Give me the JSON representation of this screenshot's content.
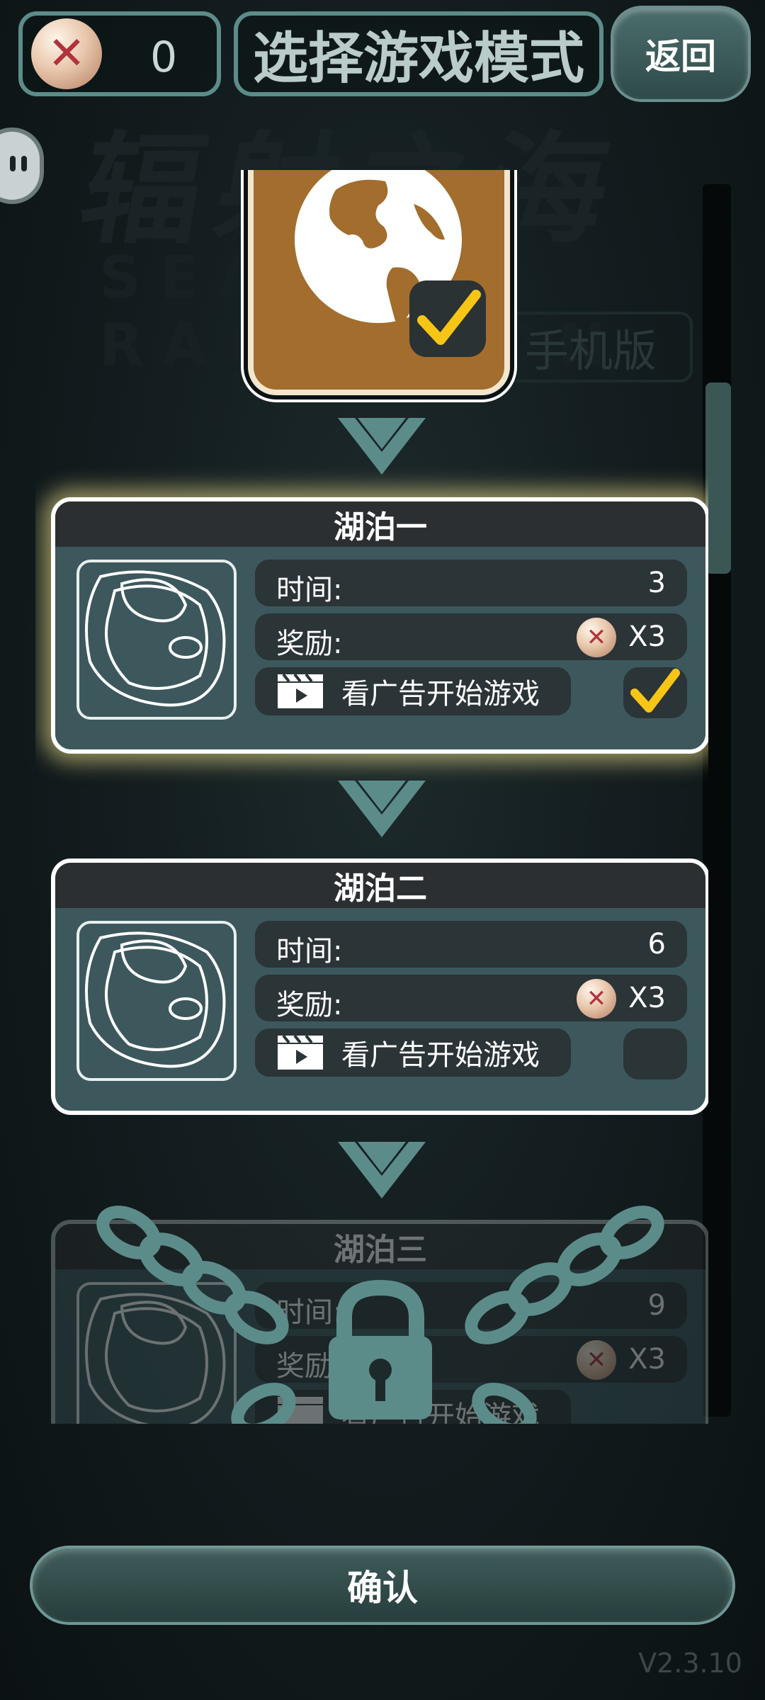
{
  "header": {
    "coin_count": "0",
    "title": "选择游戏模式",
    "back_label": "返回"
  },
  "background": {
    "title": "辐射之海",
    "subtitle": "SEA OF RADIATION",
    "edition": "手机版"
  },
  "levels": [
    {
      "name": "湖泊一",
      "time_label": "时间:",
      "time_value": "3",
      "reward_label": "奖励:",
      "reward_value": "X3",
      "ad_label": "看广告开始游戏",
      "checked": true,
      "locked": false
    },
    {
      "name": "湖泊二",
      "time_label": "时间:",
      "time_value": "6",
      "reward_label": "奖励:",
      "reward_value": "X3",
      "ad_label": "看广告开始游戏",
      "checked": false,
      "locked": false
    },
    {
      "name": "湖泊三",
      "time_label": "时间:",
      "time_value": "9",
      "reward_label": "奖励:",
      "reward_value": "X3",
      "ad_label": "看广告开始游戏",
      "checked": false,
      "locked": true
    }
  ],
  "footer": {
    "confirm_label": "确认",
    "version": "V2.3.10"
  },
  "colors": {
    "accent": "#5c8c8a",
    "checkmark": "#f7c515",
    "planet_card": "#a26d2d"
  },
  "scroll_position": 0.22
}
